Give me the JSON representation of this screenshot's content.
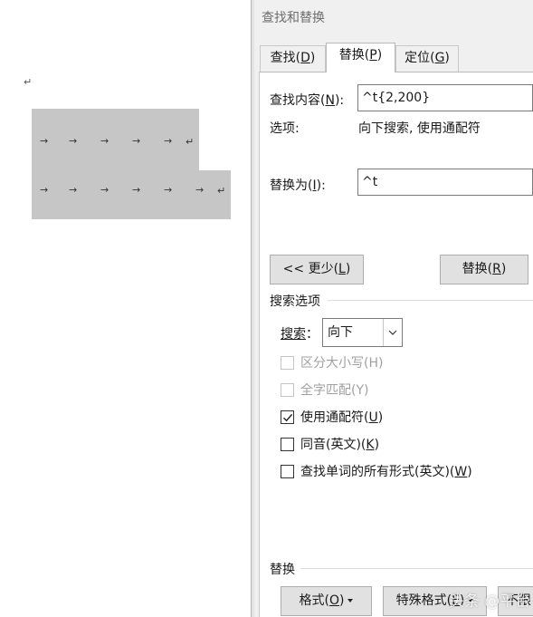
{
  "document": {
    "para_mark": "↵",
    "rows": [
      {
        "arrows": [
          "→",
          "→",
          "→",
          "→",
          "→"
        ],
        "end_mark": "↵"
      },
      {
        "arrows": [
          "→",
          "→",
          "→",
          "→",
          "→",
          "→"
        ],
        "end_mark": "↵"
      }
    ]
  },
  "dialog": {
    "title": "查找和替换",
    "tabs": [
      {
        "label": "查找(",
        "key": "D",
        "suffix": ")",
        "active": false
      },
      {
        "label": "替换(",
        "key": "P",
        "suffix": ")",
        "active": true
      },
      {
        "label": "定位(",
        "key": "G",
        "suffix": ")",
        "active": false
      }
    ],
    "find": {
      "label": "查找内容(",
      "key": "N",
      "suffix": "):",
      "value": "^t{2,200}"
    },
    "options": {
      "label": "选项:",
      "value": "向下搜索, 使用通配符"
    },
    "replace": {
      "label": "替换为(",
      "key": "I",
      "suffix": "):",
      "value": "^t"
    },
    "buttons": {
      "less": {
        "label": "<< 更少(",
        "key": "L",
        "suffix": ")"
      },
      "replace": {
        "label": "替换(",
        "key": "R",
        "suffix": ")"
      }
    },
    "search_options": {
      "title": "搜索选项",
      "search_label": "搜索",
      "search_key": "：",
      "search_value": "向下",
      "checkboxes": [
        {
          "label": "区分大小写(",
          "key": "H",
          "suffix": ")",
          "checked": false,
          "enabled": false
        },
        {
          "label": "全字匹配(",
          "key": "Y",
          "suffix": ")",
          "checked": false,
          "enabled": false
        },
        {
          "label": "使用通配符(",
          "key": "U",
          "suffix": ")",
          "checked": true,
          "enabled": true
        },
        {
          "label": "同音(英文)(",
          "key": "K",
          "suffix": ")",
          "checked": false,
          "enabled": true
        },
        {
          "label": "查找单词的所有形式(英文)(",
          "key": "W",
          "suffix": ")",
          "checked": false,
          "enabled": true
        }
      ]
    },
    "replace_section": {
      "title": "替换",
      "format_button": {
        "label": "格式(",
        "key": "O",
        "suffix": ")"
      },
      "special_button": {
        "label": "特殊格式(",
        "key": "E",
        "suffix": ")"
      },
      "no_format_button": {
        "label": "不限"
      }
    },
    "watermark": "头条 @平台"
  },
  "colors": {
    "selection": "#c6c6c6",
    "dialog_bg": "#f0f0f0",
    "button_bg": "#e1e1e1"
  }
}
